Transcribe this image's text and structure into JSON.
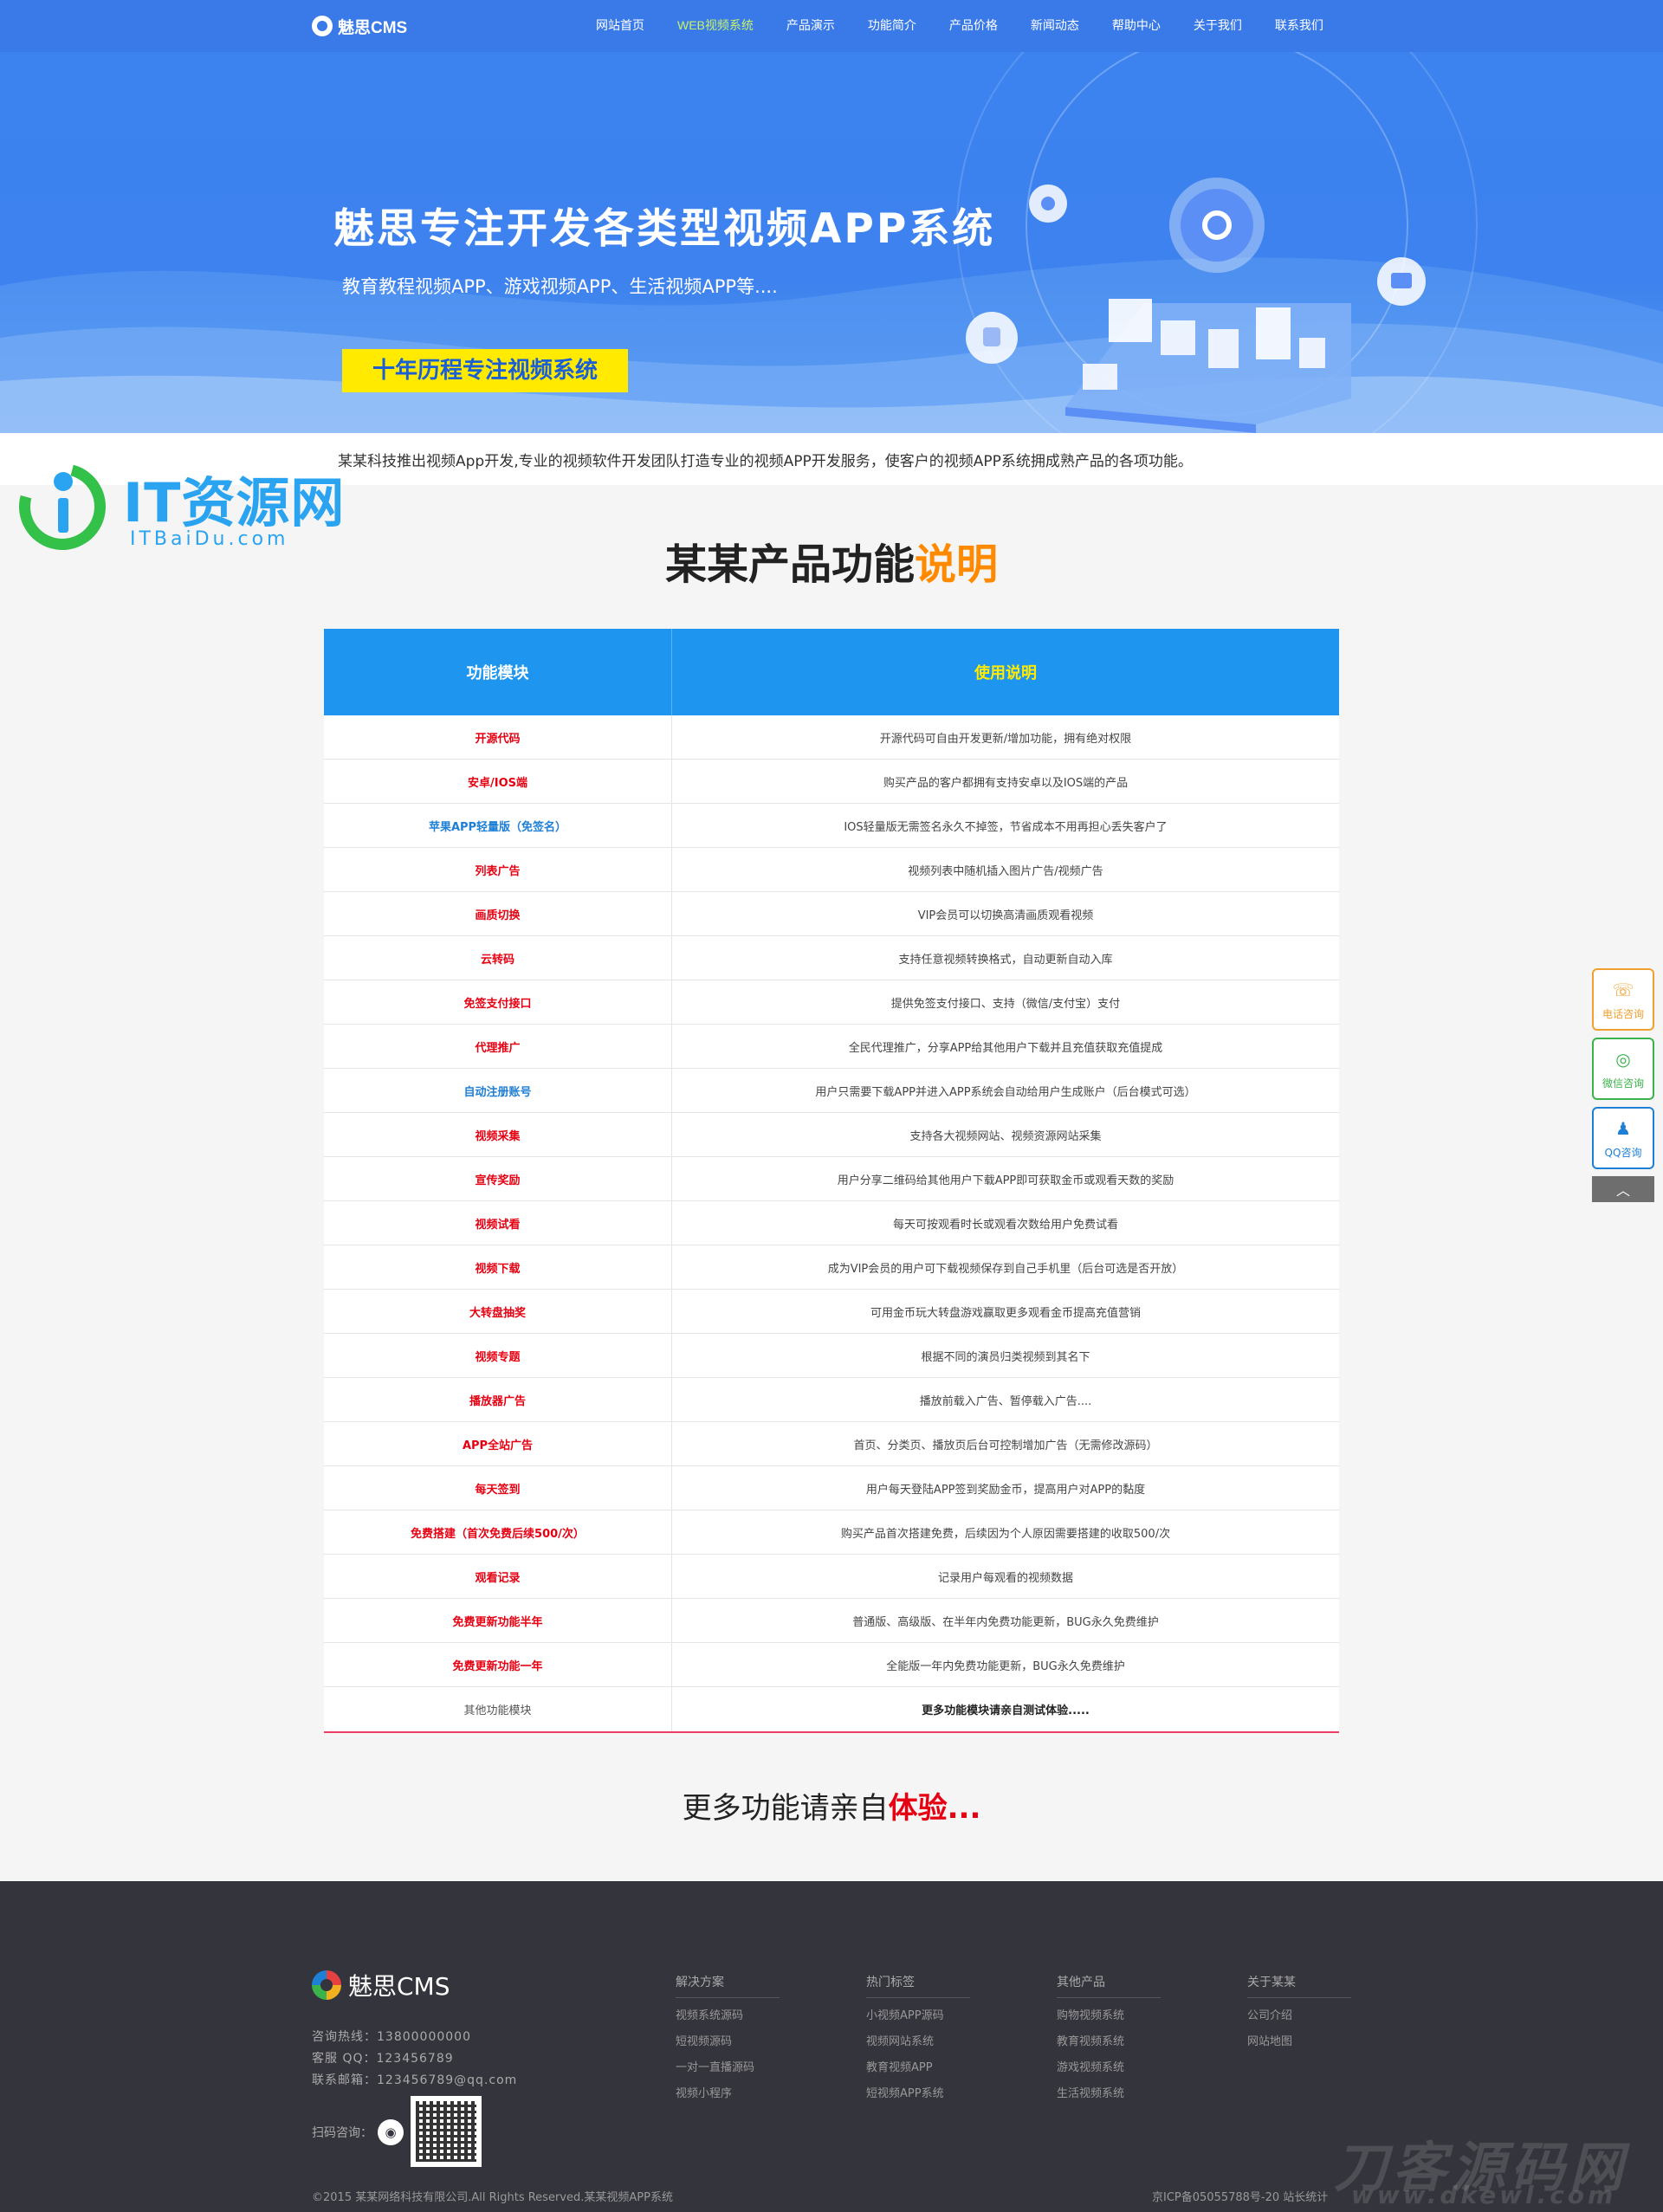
{
  "header": {
    "logo_text": "魅思CMS",
    "nav": [
      {
        "label": "网站首页",
        "active": false
      },
      {
        "label": "WEB视频系统",
        "active": true
      },
      {
        "label": "产品演示",
        "active": false
      },
      {
        "label": "功能简介",
        "active": false
      },
      {
        "label": "产品价格",
        "active": false
      },
      {
        "label": "新闻动态",
        "active": false
      },
      {
        "label": "帮助中心",
        "active": false
      },
      {
        "label": "关于我们",
        "active": false
      },
      {
        "label": "联系我们",
        "active": false
      }
    ]
  },
  "banner": {
    "title": "魅思专注开发各类型视频APP系统",
    "subtitle": "教育教程视频APP、游戏视频APP、生活视频APP等....",
    "badge": "十年历程专注视频系统"
  },
  "intro": "某某科技推出视频App开发,专业的视频软件开发团队打造专业的视频APP开发服务，使客户的视频APP系统拥成熟产品的各项功能。",
  "watermark": {
    "text": "IT资源网",
    "sub": "ITBaiDu.com"
  },
  "section": {
    "title": "某某产品功能",
    "title_hl": "说明"
  },
  "table": {
    "headers": {
      "module": "功能模块",
      "desc": "使用说明"
    },
    "rows": [
      {
        "module": "开源代码",
        "desc": "开源代码可自由开发更新/增加功能，拥有绝对权限",
        "style": "red"
      },
      {
        "module": "安卓/IOS端",
        "desc": "购买产品的客户都拥有支持安卓以及IOS端的产品",
        "style": "red"
      },
      {
        "module": "苹果APP轻量版（免签名）",
        "desc": "IOS轻量版无需签名永久不掉签，节省成本不用再担心丢失客户了",
        "style": "blue"
      },
      {
        "module": "列表广告",
        "desc": "视频列表中随机插入图片广告/视频广告",
        "style": "red"
      },
      {
        "module": "画质切换",
        "desc": "VIP会员可以切换高清画质观看视频",
        "style": "red"
      },
      {
        "module": "云转码",
        "desc": "支持任意视频转换格式，自动更新自动入库",
        "style": "red"
      },
      {
        "module": "免签支付接口",
        "desc": "提供免签支付接口、支持（微信/支付宝）支付",
        "style": "red"
      },
      {
        "module": "代理推广",
        "desc": "全民代理推广，分享APP给其他用户下载并且充值获取充值提成",
        "style": "red"
      },
      {
        "module": "自动注册账号",
        "desc": "用户只需要下载APP并进入APP系统会自动给用户生成账户（后台模式可选）",
        "style": "blue"
      },
      {
        "module": "视频采集",
        "desc": "支持各大视频网站、视频资源网站采集",
        "style": "red"
      },
      {
        "module": "宣传奖励",
        "desc": "用户分享二维码给其他用户下载APP即可获取金币或观看天数的奖励",
        "style": "red"
      },
      {
        "module": "视频试看",
        "desc": "每天可按观看时长或观看次数给用户免费试看",
        "style": "red"
      },
      {
        "module": "视频下载",
        "desc": "成为VIP会员的用户可下载视频保存到自己手机里（后台可选是否开放）",
        "style": "red"
      },
      {
        "module": "大转盘抽奖",
        "desc": "可用金币玩大转盘游戏赢取更多观看金币提高充值营销",
        "style": "red"
      },
      {
        "module": "视频专题",
        "desc": "根据不同的演员归类视频到其名下",
        "style": "red"
      },
      {
        "module": "播放器广告",
        "desc": "播放前载入广告、暂停载入广告....",
        "style": "red"
      },
      {
        "module": "APP全站广告",
        "desc": "首页、分类页、播放页后台可控制增加广告（无需修改源码）",
        "style": "red"
      },
      {
        "module": "每天签到",
        "desc": "用户每天登陆APP签到奖励金币，提高用户对APP的黏度",
        "style": "red"
      },
      {
        "module": "免费搭建（首次免费后续500/次）",
        "desc": "购买产品首次搭建免费，后续因为个人原因需要搭建的收取500/次",
        "style": "red"
      },
      {
        "module": "观看记录",
        "desc": "记录用户每观看的视频数据",
        "style": "red"
      },
      {
        "module": "免费更新功能半年",
        "desc": "普通版、高级版、在半年内免费功能更新，BUG永久免费维护",
        "style": "red"
      },
      {
        "module": "免费更新功能一年",
        "desc": "全能版一年内免费功能更新，BUG永久免费维护",
        "style": "red"
      },
      {
        "module": "其他功能模块",
        "desc": "更多功能模块请亲自测试体验.....",
        "style": "gray"
      }
    ]
  },
  "more": {
    "text": "更多功能请亲自",
    "hl": "体验..."
  },
  "side": {
    "phone": "电话咨询",
    "wechat": "微信咨询",
    "qq": "QQ咨询",
    "top_icon": "chevron-up-icon"
  },
  "footer": {
    "logo_text": "魅思CMS",
    "hotline": "咨询热线：13800000000",
    "qq": "客服 QQ：123456789",
    "email": "联系邮箱：123456789@qq.com",
    "qr_label": "扫码咨询：",
    "columns": [
      {
        "title": "解决方案",
        "links": [
          "视频系统源码",
          "短视频源码",
          "一对一直播源码",
          "视频小程序"
        ]
      },
      {
        "title": "热门标签",
        "links": [
          "小视频APP源码",
          "视频网站系统",
          "教育视频APP",
          "短视频APP系统"
        ]
      },
      {
        "title": "其他产品",
        "links": [
          "购物视频系统",
          "教育视频系统",
          "游戏视频系统",
          "生活视频系统"
        ]
      },
      {
        "title": "关于某某",
        "links": [
          "公司介绍",
          "网站地图"
        ]
      }
    ],
    "copyright": "©2015 某某网络科技有限公司.All Rights Reserved.某某视频APP系统",
    "icp": "京ICP备05055788号-20  站长统计",
    "watermark": "刀客源码网",
    "watermark_url": "www.dkewl.com"
  },
  "colors": {
    "header_bg": "#3a7ae8",
    "nav_active": "#c7f36a",
    "table_head": "#1e96f0",
    "accent_red": "#e60012",
    "accent_orange": "#ff8a00",
    "footer_bg": "#34343c"
  }
}
